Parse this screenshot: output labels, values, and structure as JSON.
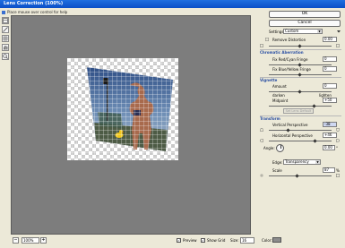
{
  "window": {
    "title": "Lens Correction (100%)"
  },
  "hint": {
    "text": "Place mouse over control for help"
  },
  "buttons": {
    "ok": "OK",
    "cancel": "Cancel"
  },
  "panel": {
    "settings_label": "Settings:",
    "settings_value": "Custom",
    "remove_distortion_label": "Remove Distortion",
    "remove_distortion_value": "0.00",
    "chromatic_title": "Chromatic Aberration",
    "fix_red_cyan_label": "Fix Red/Cyan Fringe",
    "fix_red_cyan_value": "0",
    "fix_blue_yellow_label": "Fix Blue/Yellow Fringe",
    "fix_blue_yellow_value": "0",
    "vignette_title": "Vignette",
    "amount_label": "Amount",
    "amount_value": "0",
    "darken_label": "darken",
    "lighten_label": "lighten",
    "midpoint_label": "Midpoint",
    "midpoint_value": "+50",
    "set_lens_default_label": "Set Lens Default",
    "transform_title": "Transform",
    "vertical_perspective_label": "Vertical Perspective",
    "vertical_perspective_value": "-38",
    "horizontal_perspective_label": "Horizontal Perspective",
    "horizontal_perspective_value": "+46",
    "angle_label": "Angle:",
    "angle_value": "0.00",
    "angle_unit": "°",
    "edge_label": "Edge:",
    "edge_value": "Transparency",
    "scale_label": "Scale",
    "scale_value": "87",
    "scale_unit": "%"
  },
  "statusbar": {
    "zoom_out": "−",
    "zoom_in": "+",
    "zoom_value": "100%",
    "preview_label": "Preview",
    "show_grid_label": "Show Grid",
    "size_label": "Size:",
    "size_value": "16",
    "color_label": "Color:"
  },
  "colors": {
    "accent": "#0a4fc7",
    "section": "#2a4fa3",
    "canvas": "#7d7d7d"
  },
  "icons": {
    "tool_1": "remove-distortion-icon",
    "tool_2": "straighten-icon",
    "tool_3": "move-grid-icon",
    "tool_4": "hand-icon",
    "tool_5": "zoom-icon"
  }
}
